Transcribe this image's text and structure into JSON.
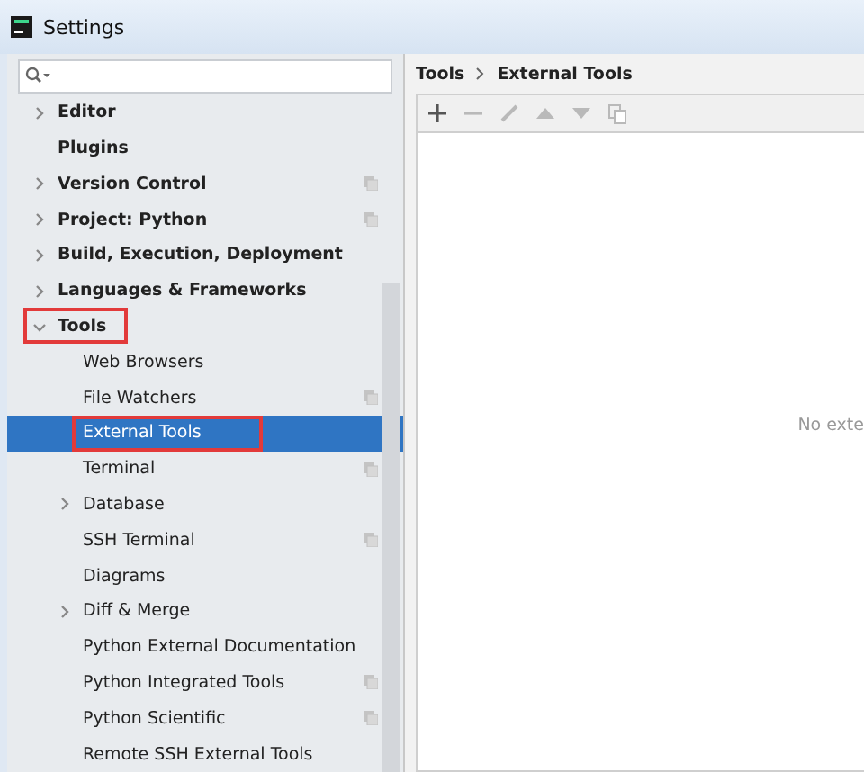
{
  "window": {
    "title": "Settings"
  },
  "tree": [
    {
      "label": "Editor",
      "expanded": false,
      "project_level": false,
      "selected": false,
      "annotated": false
    },
    {
      "label": "Plugins",
      "project_level": false,
      "selected": false,
      "annotated": false
    },
    {
      "label": "Version Control",
      "expanded": false,
      "project_level": true,
      "selected": false,
      "annotated": false
    },
    {
      "label": "Project: Python",
      "expanded": false,
      "project_level": true,
      "selected": false,
      "annotated": false
    },
    {
      "label": "Build, Execution, Deployment",
      "expanded": false,
      "project_level": false,
      "selected": false,
      "annotated": false
    },
    {
      "label": "Languages & Frameworks",
      "expanded": false,
      "project_level": false,
      "selected": false,
      "annotated": false
    },
    {
      "label": "Tools",
      "expanded": true,
      "project_level": false,
      "selected": false,
      "annotated": true,
      "children": [
        {
          "label": "Web Browsers",
          "project_level": false,
          "selected": false,
          "annotated": false
        },
        {
          "label": "File Watchers",
          "project_level": true,
          "selected": false,
          "annotated": false
        },
        {
          "label": "External Tools",
          "project_level": false,
          "selected": true,
          "annotated": true
        },
        {
          "label": "Terminal",
          "project_level": true,
          "selected": false,
          "annotated": false
        },
        {
          "label": "Database",
          "expanded": false,
          "project_level": false,
          "selected": false,
          "annotated": false
        },
        {
          "label": "SSH Terminal",
          "project_level": true,
          "selected": false,
          "annotated": false
        },
        {
          "label": "Diagrams",
          "project_level": false,
          "selected": false,
          "annotated": false
        },
        {
          "label": "Diff & Merge",
          "expanded": false,
          "project_level": false,
          "selected": false,
          "annotated": false
        },
        {
          "label": "Python External Documentation",
          "project_level": false,
          "selected": false,
          "annotated": false
        },
        {
          "label": "Python Integrated Tools",
          "project_level": true,
          "selected": false,
          "annotated": false
        },
        {
          "label": "Python Scientific",
          "project_level": true,
          "selected": false,
          "annotated": false
        },
        {
          "label": "Remote SSH External Tools",
          "project_level": false,
          "selected": false,
          "annotated": false
        }
      ]
    }
  ],
  "breadcrumb": [
    "Tools",
    "External Tools"
  ],
  "toolbar": [
    {
      "kind": "add",
      "disabled": false
    },
    {
      "kind": "remove",
      "disabled": true
    },
    {
      "kind": "edit",
      "disabled": true
    },
    {
      "kind": "up",
      "disabled": true
    },
    {
      "kind": "down",
      "disabled": true
    },
    {
      "kind": "copy",
      "disabled": true
    }
  ],
  "empty_text": "No exte"
}
